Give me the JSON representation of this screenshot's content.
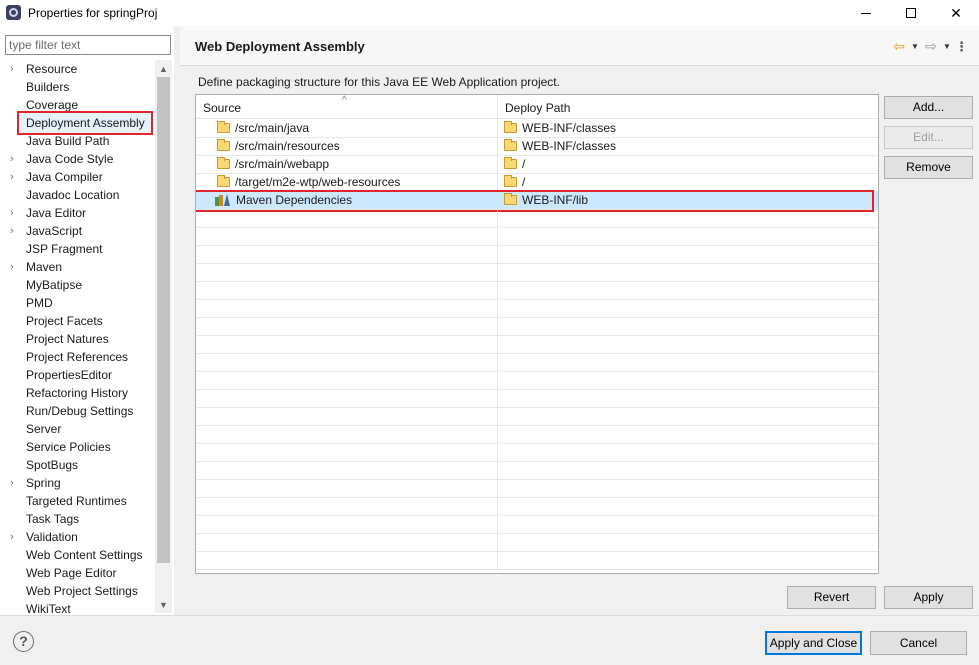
{
  "window": {
    "title": "Properties for springProj",
    "minimize": "—",
    "maximize": "☐",
    "close": "✕"
  },
  "filter": {
    "placeholder": "type filter text",
    "value": ""
  },
  "tree": {
    "items": [
      {
        "label": "Resource",
        "expandable": true
      },
      {
        "label": "Builders",
        "expandable": false
      },
      {
        "label": "Coverage",
        "expandable": false
      },
      {
        "label": "Deployment Assembly",
        "expandable": false,
        "selected": true
      },
      {
        "label": "Java Build Path",
        "expandable": false
      },
      {
        "label": "Java Code Style",
        "expandable": true
      },
      {
        "label": "Java Compiler",
        "expandable": true
      },
      {
        "label": "Javadoc Location",
        "expandable": false
      },
      {
        "label": "Java Editor",
        "expandable": true
      },
      {
        "label": "JavaScript",
        "expandable": true
      },
      {
        "label": "JSP Fragment",
        "expandable": false
      },
      {
        "label": "Maven",
        "expandable": true
      },
      {
        "label": "MyBatipse",
        "expandable": false
      },
      {
        "label": "PMD",
        "expandable": false
      },
      {
        "label": "Project Facets",
        "expandable": false
      },
      {
        "label": "Project Natures",
        "expandable": false
      },
      {
        "label": "Project References",
        "expandable": false
      },
      {
        "label": "PropertiesEditor",
        "expandable": false
      },
      {
        "label": "Refactoring History",
        "expandable": false
      },
      {
        "label": "Run/Debug Settings",
        "expandable": false
      },
      {
        "label": "Server",
        "expandable": false
      },
      {
        "label": "Service Policies",
        "expandable": false
      },
      {
        "label": "SpotBugs",
        "expandable": false
      },
      {
        "label": "Spring",
        "expandable": true
      },
      {
        "label": "Targeted Runtimes",
        "expandable": false
      },
      {
        "label": "Task Tags",
        "expandable": false
      },
      {
        "label": "Validation",
        "expandable": true
      },
      {
        "label": "Web Content Settings",
        "expandable": false
      },
      {
        "label": "Web Page Editor",
        "expandable": false
      },
      {
        "label": "Web Project Settings",
        "expandable": false
      },
      {
        "label": "WikiText",
        "expandable": false
      }
    ]
  },
  "page": {
    "title": "Web Deployment Assembly",
    "description": "Define packaging structure for this Java EE Web Application project.",
    "nav": {
      "back": "⇦",
      "forward": "⇨",
      "menu": "⋮",
      "dropdown": "▼"
    }
  },
  "table": {
    "headers": {
      "source": "Source",
      "deploy": "Deploy Path"
    },
    "rows": [
      {
        "source": "/src/main/java",
        "deploy": "WEB-INF/classes",
        "icon": "folder-icon"
      },
      {
        "source": "/src/main/resources",
        "deploy": "WEB-INF/classes",
        "icon": "folder-icon"
      },
      {
        "source": "/src/main/webapp",
        "deploy": "/",
        "icon": "folder-icon"
      },
      {
        "source": "/target/m2e-wtp/web-resources",
        "deploy": "/",
        "icon": "folder-icon"
      },
      {
        "source": "Maven Dependencies",
        "deploy": "WEB-INF/lib",
        "icon": "library-icon",
        "selected": true
      }
    ]
  },
  "buttons": {
    "add": "Add...",
    "edit": "Edit...",
    "remove": "Remove",
    "revert": "Revert",
    "apply": "Apply",
    "apply_close": "Apply and Close",
    "cancel": "Cancel",
    "help": "?"
  },
  "colors": {
    "highlight_border": "#e0252b",
    "selection": "#cce8ff",
    "default_button_border": "#0078d7"
  }
}
